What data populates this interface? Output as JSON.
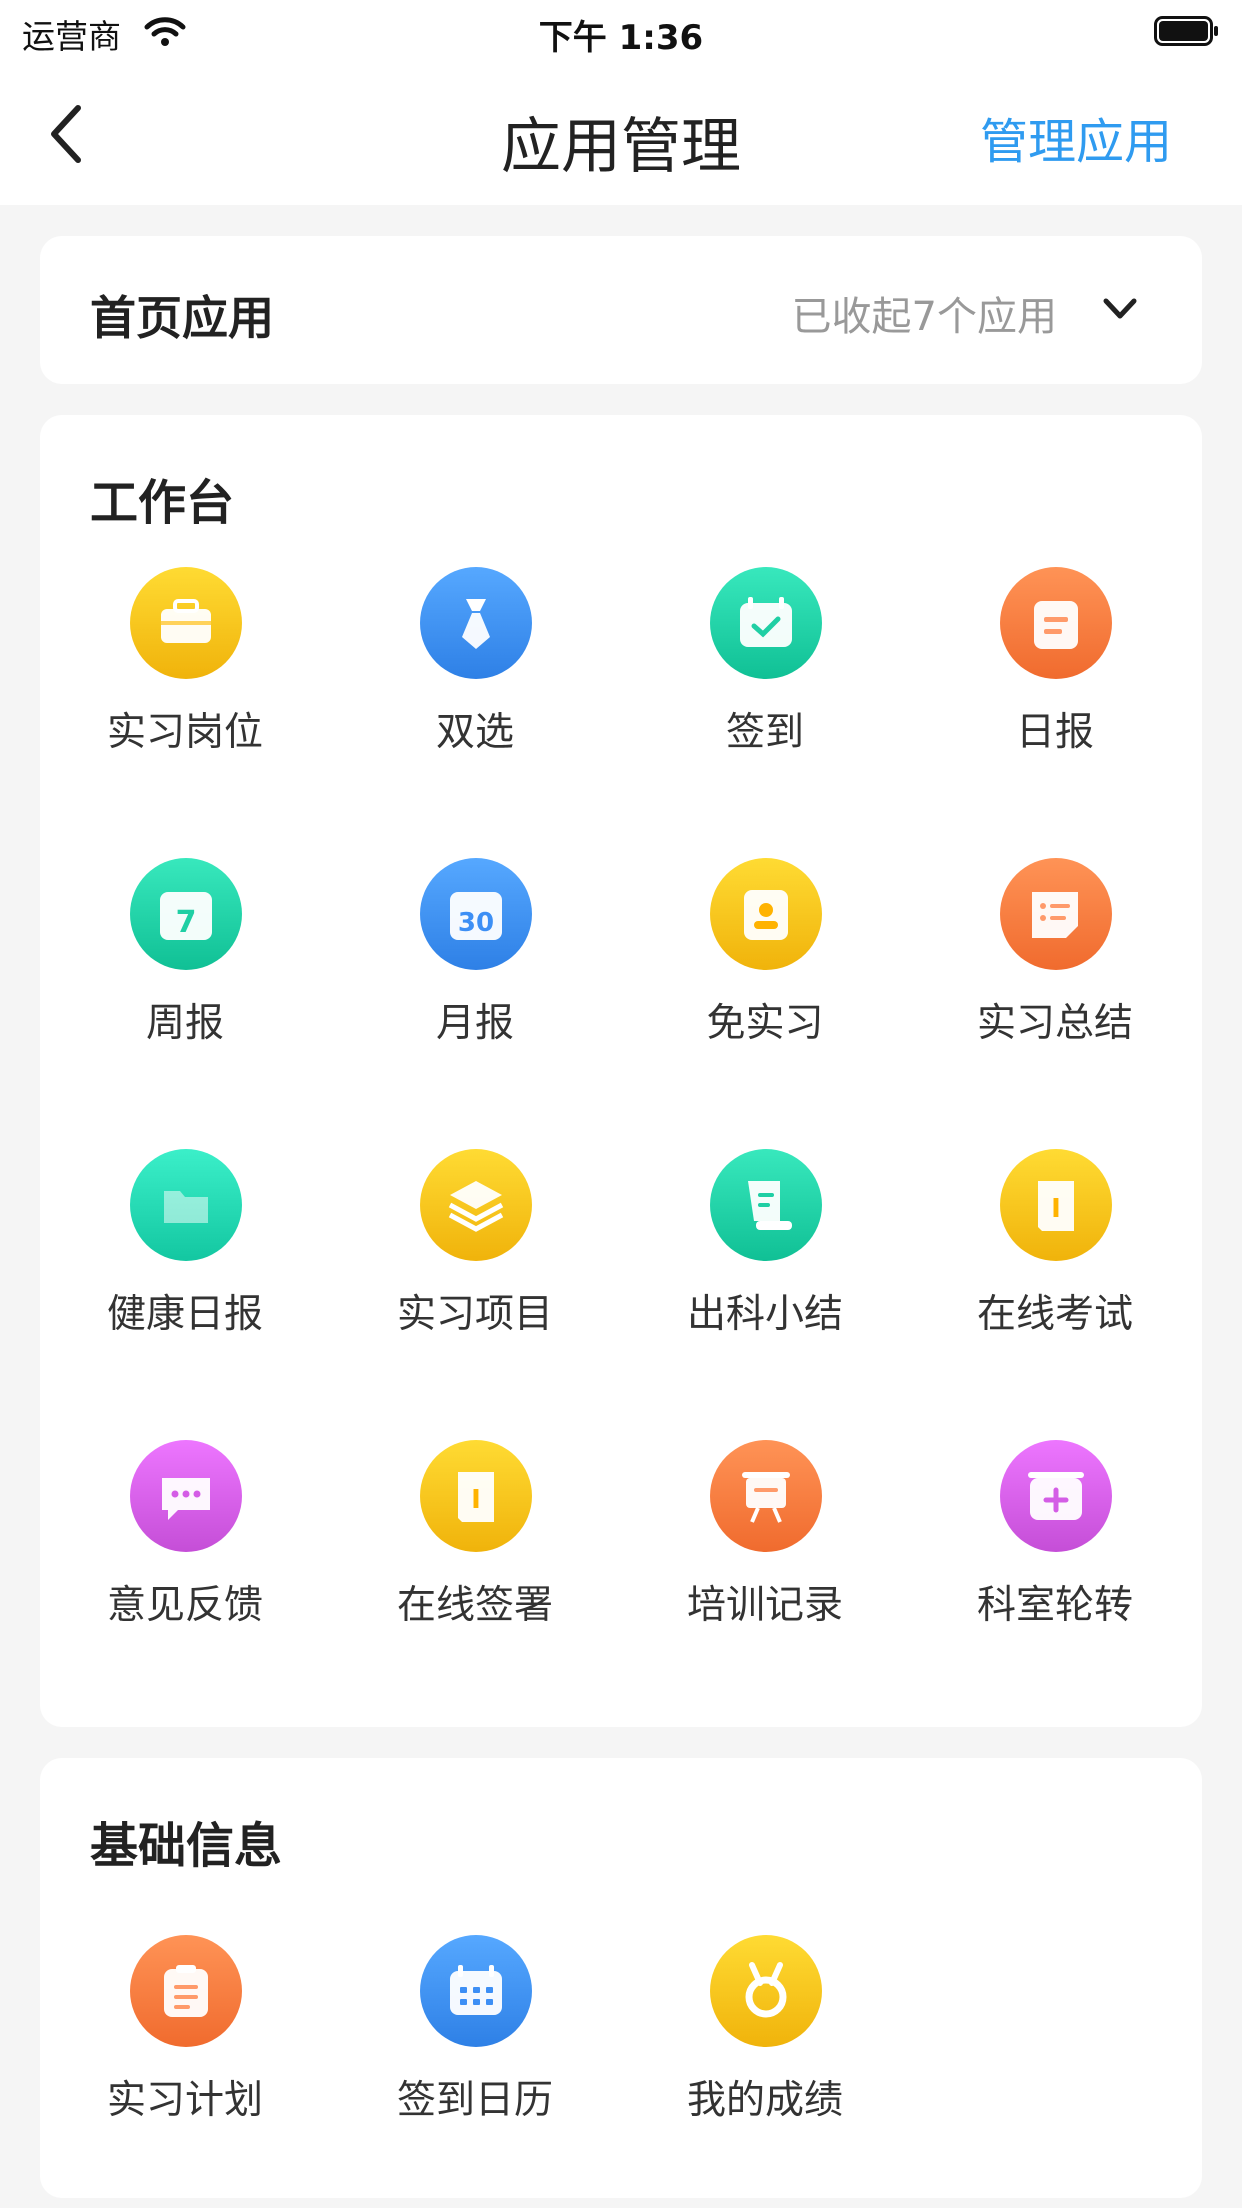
{
  "status": {
    "carrier": "运营商",
    "time": "下午 1:36"
  },
  "nav": {
    "title": "应用管理",
    "action": "管理应用"
  },
  "home_apps": {
    "title": "首页应用",
    "status": "已收起7个应用"
  },
  "workbench": {
    "title": "工作台",
    "items": [
      {
        "label": "实习岗位",
        "icon": "briefcase-icon",
        "color": "#ffc21a"
      },
      {
        "label": "双选",
        "icon": "tie-icon",
        "color": "#3d8ff5"
      },
      {
        "label": "签到",
        "icon": "calendar-check-icon",
        "color": "#1fcfa4"
      },
      {
        "label": "日报",
        "icon": "daily-report-icon",
        "color": "#ff7a3d"
      },
      {
        "label": "周报",
        "icon": "weekly-calendar-icon",
        "color": "#1fcfa4"
      },
      {
        "label": "月报",
        "icon": "monthly-calendar-icon",
        "color": "#3d8ff5"
      },
      {
        "label": "免实习",
        "icon": "exemption-badge-icon",
        "color": "#ffc21a"
      },
      {
        "label": "实习总结",
        "icon": "summary-note-icon",
        "color": "#ff7a3d"
      },
      {
        "label": "健康日报",
        "icon": "folder-icon",
        "color": "#22d6b0"
      },
      {
        "label": "实习项目",
        "icon": "layers-icon",
        "color": "#ffc21a"
      },
      {
        "label": "出科小结",
        "icon": "scroll-icon",
        "color": "#1fcfa4"
      },
      {
        "label": "在线考试",
        "icon": "exam-book-icon",
        "color": "#ffc21a"
      },
      {
        "label": "意见反馈",
        "icon": "chat-bubble-icon",
        "color": "#d45de6"
      },
      {
        "label": "在线签署",
        "icon": "sign-book-icon",
        "color": "#ffc21a"
      },
      {
        "label": "培训记录",
        "icon": "presentation-board-icon",
        "color": "#ff7a3d"
      },
      {
        "label": "科室轮转",
        "icon": "medical-calendar-icon",
        "color": "#d45de6"
      }
    ]
  },
  "basic_info": {
    "title": "基础信息",
    "items": [
      {
        "label": "实习计划",
        "icon": "plan-clipboard-icon",
        "color": "#ff7a3d"
      },
      {
        "label": "签到日历",
        "icon": "calendar-grid-icon",
        "color": "#3d8ff5"
      },
      {
        "label": "我的成绩",
        "icon": "medal-icon",
        "color": "#ffc21a"
      }
    ]
  }
}
